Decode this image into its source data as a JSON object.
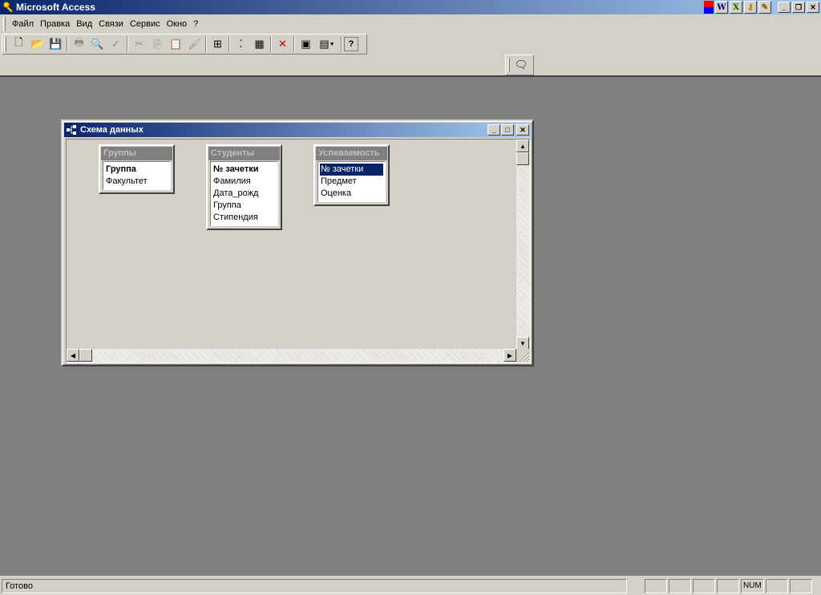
{
  "app": {
    "title": "Microsoft Access"
  },
  "menu": [
    {
      "label": "Файл"
    },
    {
      "label": "Правка"
    },
    {
      "label": "Вид"
    },
    {
      "label": "Связи"
    },
    {
      "label": "Сервис"
    },
    {
      "label": "Окно"
    },
    {
      "label": "?"
    }
  ],
  "toolbar": {
    "buttons": [
      {
        "icon": "new-icon",
        "glyph": "🗋",
        "disabled": false
      },
      {
        "icon": "open-icon",
        "glyph": "📂",
        "disabled": false
      },
      {
        "icon": "save-icon",
        "glyph": "💾",
        "disabled": false
      },
      {
        "icon": "print-icon",
        "glyph": "🖶",
        "disabled": true
      },
      {
        "icon": "print-preview-icon",
        "glyph": "🔍",
        "disabled": true
      },
      {
        "icon": "spelling-icon",
        "glyph": "✓",
        "disabled": true
      },
      {
        "icon": "cut-icon",
        "glyph": "✂",
        "disabled": true
      },
      {
        "icon": "copy-icon",
        "glyph": "⎘",
        "disabled": true
      },
      {
        "icon": "paste-icon",
        "glyph": "📋",
        "disabled": true
      },
      {
        "icon": "format-painter-icon",
        "glyph": "🖌",
        "disabled": true
      },
      {
        "icon": "show-table-icon",
        "glyph": "⊞",
        "disabled": false
      },
      {
        "icon": "show-direct-icon",
        "glyph": "⁚",
        "disabled": false
      },
      {
        "icon": "show-all-icon",
        "glyph": "▦",
        "disabled": false
      },
      {
        "icon": "delete-icon",
        "glyph": "✕",
        "disabled": false
      },
      {
        "icon": "database-window-icon",
        "glyph": "▣",
        "disabled": false
      },
      {
        "icon": "new-object-icon",
        "glyph": "▤",
        "disabled": false
      },
      {
        "icon": "help-icon",
        "glyph": "?",
        "disabled": false
      }
    ]
  },
  "relationships_window": {
    "title": "Схема данных",
    "tables": [
      {
        "name": "Группы",
        "fields": [
          {
            "label": "Группа",
            "key": true
          },
          {
            "label": "Факультет",
            "key": false
          }
        ]
      },
      {
        "name": "Студенты",
        "fields": [
          {
            "label": "№ зачетки",
            "key": true
          },
          {
            "label": "Фамилия",
            "key": false
          },
          {
            "label": "Дата_рожд",
            "key": false
          },
          {
            "label": "Группа",
            "key": false
          },
          {
            "label": "Стипендия",
            "key": false
          }
        ]
      },
      {
        "name": "Успеваемость",
        "fields": [
          {
            "label": "№ зачетки",
            "key": false,
            "selected": true
          },
          {
            "label": "Предмет",
            "key": false
          },
          {
            "label": "Оценка",
            "key": false
          }
        ]
      }
    ]
  },
  "status": {
    "text": "Готово",
    "num": "NUM"
  },
  "colors": {
    "title_active": "#0a246a",
    "title_gradient_end": "#a6caf0",
    "face": "#d4d0c8",
    "mdi_background": "#808080"
  }
}
